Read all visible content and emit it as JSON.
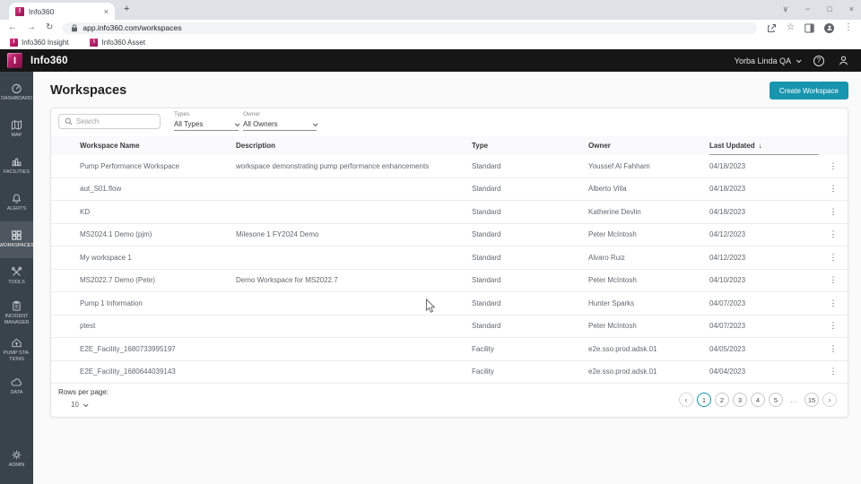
{
  "browser": {
    "tab_title": "Info360",
    "favicon_letter": "I",
    "url": "app.info360.com/workspaces",
    "bookmarks": [
      {
        "label": "Info360 Insight"
      },
      {
        "label": "Info360 Asset"
      }
    ],
    "window_controls": [
      {
        "glyph": "∨"
      },
      {
        "glyph": "−"
      },
      {
        "glyph": "□"
      },
      {
        "glyph": "×"
      }
    ]
  },
  "icons": {
    "back": "←",
    "forward": "→",
    "reload": "↻",
    "star": "☆",
    "kebab": "⋮",
    "close": "×",
    "new_tab": "+",
    "help": "?",
    "prev": "‹",
    "next": "›"
  },
  "app_bar": {
    "brand": "Info360",
    "logo_letter": "I",
    "tenant": "Yorba Linda QA"
  },
  "sidebar": {
    "items": [
      {
        "label": "DASHBOARD",
        "icon": "gauge"
      },
      {
        "label": "MAP",
        "icon": "map"
      },
      {
        "label": "FACILITIES",
        "icon": "factory"
      },
      {
        "label": "ALERTS",
        "icon": "bell"
      },
      {
        "label": "WORKSPACES",
        "icon": "grid",
        "active": true
      },
      {
        "label": "TOOLS",
        "icon": "tools"
      },
      {
        "label": "INCIDENT MANAGER",
        "icon": "clipboard"
      },
      {
        "label": "PUMP STA-TIONS",
        "icon": "pump"
      },
      {
        "label": "DATA",
        "icon": "cloud"
      },
      {
        "label": "ADMIN",
        "icon": "gear",
        "bottom": true
      }
    ]
  },
  "page": {
    "title": "Workspaces",
    "create_button": "Create Workspace"
  },
  "filters": {
    "search_placeholder": "Search",
    "types_label": "Types",
    "types_value": "All Types",
    "owner_label": "Owner",
    "owner_value": "All Owners"
  },
  "table": {
    "columns": [
      "Workspace Name",
      "Description",
      "Type",
      "Owner",
      "Last Updated"
    ],
    "sort_indicator": "↓",
    "rows": [
      {
        "name": "Pump Performance Workspace",
        "description": "workspace demonstrating pump performance enhancements",
        "type": "Standard",
        "owner": "Youssef Al Fahham",
        "updated": "04/18/2023"
      },
      {
        "name": "aut_S01.flow",
        "description": "",
        "type": "Standard",
        "owner": "Alberto Villa",
        "updated": "04/18/2023"
      },
      {
        "name": "KD",
        "description": "",
        "type": "Standard",
        "owner": "Katherine Devlin",
        "updated": "04/18/2023"
      },
      {
        "name": "MS2024.1 Demo (pjm)",
        "description": "Milesone 1 FY2024 Demo",
        "type": "Standard",
        "owner": "Peter McIntosh",
        "updated": "04/12/2023"
      },
      {
        "name": "My workspace 1",
        "description": "",
        "type": "Standard",
        "owner": "Alvaro Ruiz",
        "updated": "04/12/2023"
      },
      {
        "name": "MS2022.7 Demo (Pete)",
        "description": "Demo Workspace for MS2022.7",
        "type": "Standard",
        "owner": "Peter McIntosh",
        "updated": "04/10/2023"
      },
      {
        "name": "Pump 1 Information",
        "description": "",
        "type": "Standard",
        "owner": "Hunter Sparks",
        "updated": "04/07/2023"
      },
      {
        "name": "ptest",
        "description": "",
        "type": "Standard",
        "owner": "Peter McIntosh",
        "updated": "04/07/2023"
      },
      {
        "name": "E2E_Facility_1680733995197",
        "description": "",
        "type": "Facility",
        "owner": "e2e.sso.prod.adsk.01",
        "updated": "04/05/2023"
      },
      {
        "name": "E2E_Facility_1680644039143",
        "description": "",
        "type": "Facility",
        "owner": "e2e.sso.prod.adsk.01",
        "updated": "04/04/2023"
      }
    ]
  },
  "footer": {
    "rows_per_page_label": "Rows per page:",
    "rows_per_page_value": "10",
    "pages": [
      {
        "label": "1",
        "active": true
      },
      {
        "label": "2"
      },
      {
        "label": "3"
      },
      {
        "label": "4"
      },
      {
        "label": "5"
      },
      {
        "label": "…",
        "ellipsis": true
      },
      {
        "label": "15"
      }
    ]
  },
  "colors": {
    "accent_teal": "#1795ae",
    "brand_magenta": "#b01d63",
    "topnav_bg": "#161616",
    "sidebar_bg": "#39434c",
    "sidebar_active_bg": "#4e575f"
  }
}
